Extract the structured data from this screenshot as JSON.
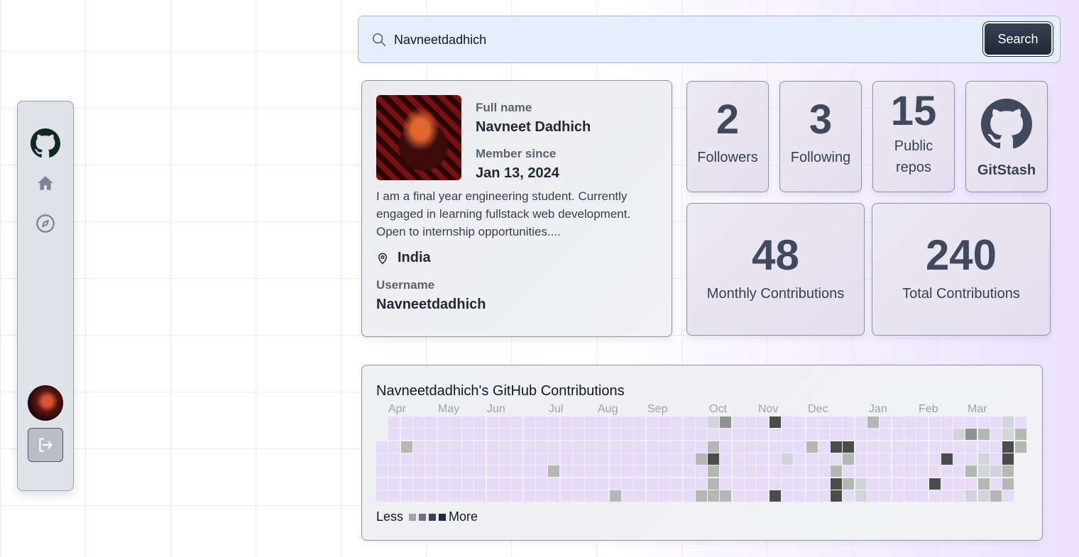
{
  "sidebar": {
    "items": [
      {
        "name": "github-logo",
        "icon": "github-icon"
      },
      {
        "name": "home",
        "icon": "home-icon"
      },
      {
        "name": "explore",
        "icon": "compass-icon"
      }
    ],
    "avatar": "user-avatar",
    "logout_icon": "logout-icon"
  },
  "search": {
    "value": "Navneetdadhich",
    "button_label": "Search",
    "icon": "search-icon"
  },
  "profile": {
    "full_name_label": "Full name",
    "full_name": "Navneet Dadhich",
    "member_since_label": "Member since",
    "member_since": "Jan 13, 2024",
    "bio": "I am a final year engineering student. Currently engaged in learning fullstack web development. Open to internship opportunities....",
    "location": "India",
    "username_label": "Username",
    "username": "Navneetdadhich"
  },
  "stats": {
    "followers": {
      "value": "2",
      "label": "Followers"
    },
    "following": {
      "value": "3",
      "label": "Following"
    },
    "repos": {
      "value": "15",
      "label": "Public repos"
    },
    "brand": "GitStash",
    "monthly": {
      "value": "48",
      "label": "Monthly Contributions"
    },
    "total": {
      "value": "240",
      "label": "Total Contributions"
    }
  },
  "contributions": {
    "title": "Navneetdadhich's GitHub Contributions",
    "months": [
      "Apr",
      "May",
      "Jun",
      "Jul",
      "Aug",
      "Sep",
      "Oct",
      "Nov",
      "Dec",
      "Jan",
      "Feb",
      "Mar"
    ],
    "legend_less": "Less",
    "legend_more": "More",
    "legend_colors": [
      "#9ca3af",
      "#6b7280",
      "#374151",
      "#1f2937"
    ],
    "weeks": 53,
    "empty_color": "#e6dcf7",
    "active_cells": [
      {
        "w": 27,
        "d": 0,
        "lvl": 1
      },
      {
        "w": 28,
        "d": 0,
        "lvl": 3
      },
      {
        "w": 32,
        "d": 0,
        "lvl": 4
      },
      {
        "w": 40,
        "d": 0,
        "lvl": 2
      },
      {
        "w": 51,
        "d": 0,
        "lvl": 1
      },
      {
        "w": 47,
        "d": 1,
        "lvl": 1
      },
      {
        "w": 48,
        "d": 1,
        "lvl": 3
      },
      {
        "w": 49,
        "d": 1,
        "lvl": 2
      },
      {
        "w": 51,
        "d": 1,
        "lvl": 1
      },
      {
        "w": 52,
        "d": 1,
        "lvl": 2
      },
      {
        "w": 2,
        "d": 2,
        "lvl": 2
      },
      {
        "w": 27,
        "d": 2,
        "lvl": 2
      },
      {
        "w": 35,
        "d": 2,
        "lvl": 2
      },
      {
        "w": 37,
        "d": 2,
        "lvl": 4
      },
      {
        "w": 38,
        "d": 2,
        "lvl": 4
      },
      {
        "w": 51,
        "d": 2,
        "lvl": 4
      },
      {
        "w": 52,
        "d": 2,
        "lvl": 2
      },
      {
        "w": 26,
        "d": 3,
        "lvl": 2
      },
      {
        "w": 27,
        "d": 3,
        "lvl": 4
      },
      {
        "w": 33,
        "d": 3,
        "lvl": 1
      },
      {
        "w": 38,
        "d": 3,
        "lvl": 2
      },
      {
        "w": 46,
        "d": 3,
        "lvl": 4
      },
      {
        "w": 49,
        "d": 3,
        "lvl": 1
      },
      {
        "w": 51,
        "d": 3,
        "lvl": 4
      },
      {
        "w": 14,
        "d": 4,
        "lvl": 2
      },
      {
        "w": 27,
        "d": 4,
        "lvl": 2
      },
      {
        "w": 37,
        "d": 4,
        "lvl": 2
      },
      {
        "w": 48,
        "d": 4,
        "lvl": 2
      },
      {
        "w": 49,
        "d": 4,
        "lvl": 1
      },
      {
        "w": 50,
        "d": 4,
        "lvl": 1
      },
      {
        "w": 51,
        "d": 4,
        "lvl": 2
      },
      {
        "w": 27,
        "d": 5,
        "lvl": 2
      },
      {
        "w": 37,
        "d": 5,
        "lvl": 4
      },
      {
        "w": 38,
        "d": 5,
        "lvl": 2
      },
      {
        "w": 39,
        "d": 5,
        "lvl": 1
      },
      {
        "w": 45,
        "d": 5,
        "lvl": 4
      },
      {
        "w": 49,
        "d": 5,
        "lvl": 2
      },
      {
        "w": 51,
        "d": 5,
        "lvl": 2
      },
      {
        "w": 19,
        "d": 6,
        "lvl": 2
      },
      {
        "w": 26,
        "d": 6,
        "lvl": 2
      },
      {
        "w": 27,
        "d": 6,
        "lvl": 2
      },
      {
        "w": 28,
        "d": 6,
        "lvl": 2
      },
      {
        "w": 32,
        "d": 6,
        "lvl": 4
      },
      {
        "w": 37,
        "d": 6,
        "lvl": 4
      },
      {
        "w": 39,
        "d": 6,
        "lvl": 1
      },
      {
        "w": 48,
        "d": 6,
        "lvl": 1
      },
      {
        "w": 49,
        "d": 6,
        "lvl": 1
      },
      {
        "w": 50,
        "d": 6,
        "lvl": 2
      }
    ]
  }
}
